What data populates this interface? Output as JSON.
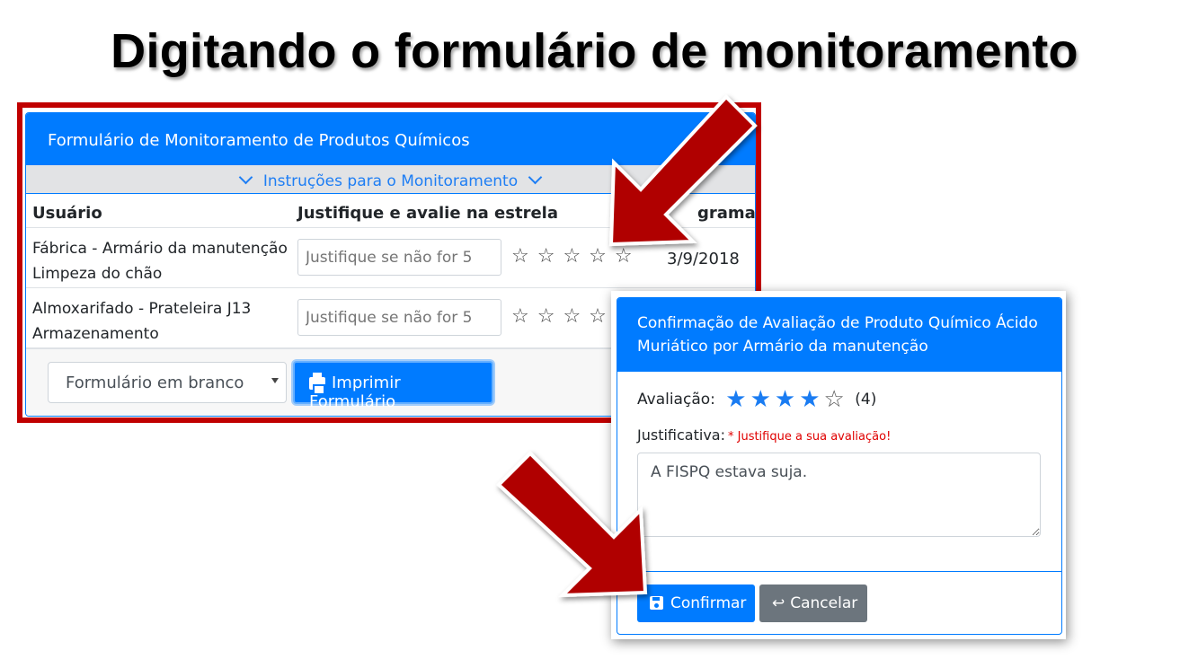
{
  "slide": {
    "title": "Digitando o formulário de monitoramento"
  },
  "form": {
    "header_title": "Formulário de Monitoramento de Produtos Químicos",
    "instructions_label": "Instruções para o Monitoramento",
    "columns": {
      "user": "Usuário",
      "justify": "Justifique e avalie na estrela",
      "scheduled": "gramado"
    },
    "rows": [
      {
        "line1": "Fábrica - Armário da manutenção",
        "line2": "Limpeza do chão",
        "placeholder": "Justifique se não for 5",
        "date": "3/9/2018",
        "stars": "☆☆☆☆☆"
      },
      {
        "line1": "Almoxarifado - Prateleira J13",
        "line2": "Armazenamento",
        "placeholder": "Justifique se não for 5",
        "date": "",
        "stars": "☆☆☆☆"
      }
    ],
    "select_value": "Formulário em branco",
    "print_button": "Imprimir Formulário"
  },
  "modal": {
    "title": "Confirmação de Avaliação de Produto Químico Ácido Muriático por Armário da manutenção",
    "rating_label": "Avaliação:",
    "rating_value": 4,
    "rating_max": 5,
    "rating_count": "(4)",
    "justify_label": "Justificativa:",
    "required_note": "* Justifique a sua avaliação!",
    "textarea_value": "A FISPQ estava suja.",
    "confirm_button": "Confirmar",
    "cancel_button": "Cancelar"
  },
  "icons": {
    "expand": "chevron-down-icon",
    "print": "printer-icon",
    "save": "save-icon",
    "cancel": "return-arrow-icon",
    "star": "star-icon"
  },
  "colors": {
    "primary": "#007bff",
    "highlight_frame": "#c00000",
    "arrow": "#b00000",
    "cancel": "#6c757d",
    "required": "#e00000"
  }
}
